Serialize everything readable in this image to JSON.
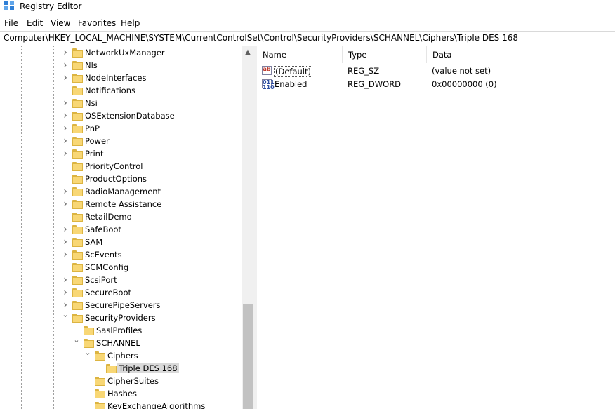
{
  "window": {
    "title": "Registry Editor"
  },
  "menu": [
    "File",
    "Edit",
    "View",
    "Favorites",
    "Help"
  ],
  "address": "Computer\\HKEY_LOCAL_MACHINE\\SYSTEM\\CurrentControlSet\\Control\\SecurityProviders\\SCHANNEL\\Ciphers\\Triple DES 168",
  "tree": {
    "items": [
      {
        "label": "NetworkUxManager",
        "expandable": true
      },
      {
        "label": "Nls",
        "expandable": true
      },
      {
        "label": "NodeInterfaces",
        "expandable": true
      },
      {
        "label": "Notifications",
        "expandable": false
      },
      {
        "label": "Nsi",
        "expandable": true
      },
      {
        "label": "OSExtensionDatabase",
        "expandable": true
      },
      {
        "label": "PnP",
        "expandable": true
      },
      {
        "label": "Power",
        "expandable": true
      },
      {
        "label": "Print",
        "expandable": true
      },
      {
        "label": "PriorityControl",
        "expandable": false
      },
      {
        "label": "ProductOptions",
        "expandable": false
      },
      {
        "label": "RadioManagement",
        "expandable": true
      },
      {
        "label": "Remote Assistance",
        "expandable": true
      },
      {
        "label": "RetailDemo",
        "expandable": false
      },
      {
        "label": "SafeBoot",
        "expandable": true
      },
      {
        "label": "SAM",
        "expandable": true
      },
      {
        "label": "ScEvents",
        "expandable": true
      },
      {
        "label": "SCMConfig",
        "expandable": false
      },
      {
        "label": "ScsiPort",
        "expandable": true
      },
      {
        "label": "SecureBoot",
        "expandable": true
      },
      {
        "label": "SecurePipeServers",
        "expandable": true
      },
      {
        "label": "SecurityProviders",
        "expanded": true
      },
      {
        "label": "SaslProfiles",
        "expandable": false
      },
      {
        "label": "SCHANNEL",
        "expanded": true
      },
      {
        "label": "Ciphers",
        "expanded": true
      },
      {
        "label": "Triple DES 168",
        "selected": true
      },
      {
        "label": "CipherSuites",
        "expandable": false
      },
      {
        "label": "Hashes",
        "expandable": false
      },
      {
        "label": "KeyExchangeAlgorithms",
        "expandable": false
      }
    ]
  },
  "list": {
    "columns": [
      "Name",
      "Type",
      "Data"
    ],
    "rows": [
      {
        "icon": "string-value-icon",
        "name": "(Default)",
        "type": "REG_SZ",
        "data": "(value not set)"
      },
      {
        "icon": "binary-value-icon",
        "name": "Enabled",
        "type": "REG_DWORD",
        "data": "0x00000000 (0)"
      }
    ]
  },
  "icons": {
    "app": "registry-editor-icon",
    "folder": "folder-icon",
    "expand": "chevron-right-icon",
    "collapse": "chevron-down-icon"
  },
  "colors": {
    "folder": "#f8d775",
    "selection": "#d9d9d9",
    "app_icon": "#2f7fd6"
  }
}
